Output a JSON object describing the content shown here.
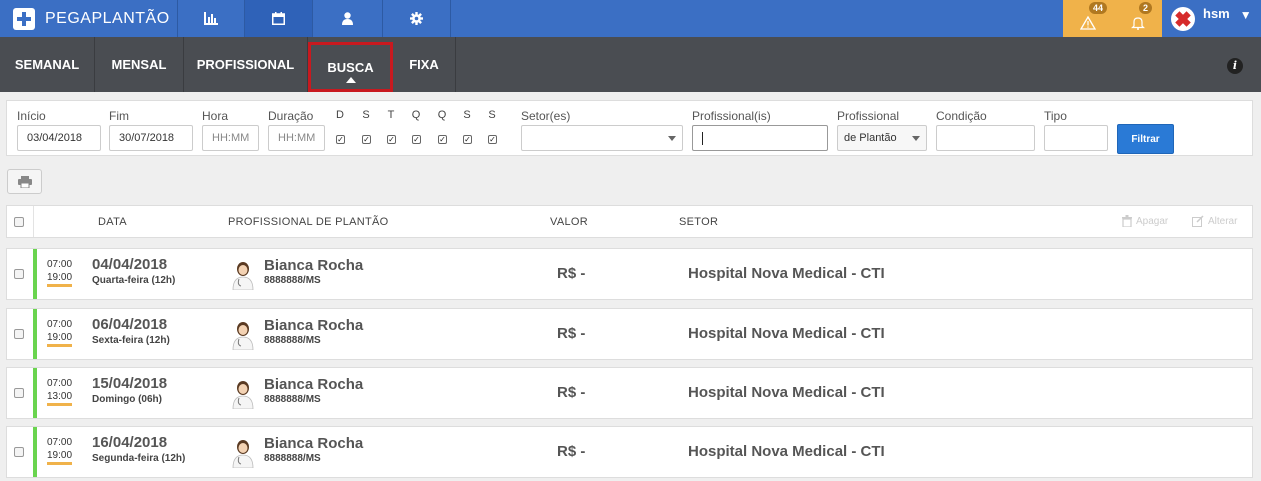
{
  "app": {
    "logo_text": "PEGAPLANTÃO"
  },
  "topnav": [
    "chart-icon",
    "calendar-icon",
    "user-icon",
    "gear-icon"
  ],
  "alerts": {
    "warnings_count": "44",
    "notifications_count": "2"
  },
  "user": {
    "name": "hsm"
  },
  "tabs": [
    "SEMANAL",
    "MENSAL",
    "PROFISSIONAL",
    "BUSCA",
    "FIXA"
  ],
  "active_tab": "BUSCA",
  "filters": {
    "inicio_label": "Início",
    "inicio_value": "03/04/2018",
    "fim_label": "Fim",
    "fim_value": "30/07/2018",
    "hora_label": "Hora",
    "hora_placeholder": "HH:MM",
    "duracao_label": "Duração",
    "duracao_placeholder": "HH:MM",
    "days": [
      "D",
      "S",
      "T",
      "Q",
      "Q",
      "S",
      "S"
    ],
    "setor_label": "Setor(es)",
    "profissionais_label": "Profissional(is)",
    "profissional_label": "Profissional",
    "profissional_value": "de Plantão",
    "condicao_label": "Condição",
    "tipo_label": "Tipo",
    "filter_button": "Filtrar"
  },
  "table": {
    "headers": {
      "data": "DATA",
      "profissional": "PROFISSIONAL DE PLANTÃO",
      "valor": "VALOR",
      "setor": "SETOR"
    },
    "actions": {
      "delete": "Apagar",
      "edit": "Alterar"
    },
    "rows": [
      {
        "start": "07:00",
        "end": "19:00",
        "date": "04/04/2018",
        "weekday": "Quarta-feira (12h)",
        "name": "Bianca Rocha",
        "reg": "8888888/MS",
        "value": "R$ -",
        "sector": "Hospital Nova Medical - CTI"
      },
      {
        "start": "07:00",
        "end": "19:00",
        "date": "06/04/2018",
        "weekday": "Sexta-feira (12h)",
        "name": "Bianca Rocha",
        "reg": "8888888/MS",
        "value": "R$ -",
        "sector": "Hospital Nova Medical - CTI"
      },
      {
        "start": "07:00",
        "end": "13:00",
        "date": "15/04/2018",
        "weekday": "Domingo (06h)",
        "name": "Bianca Rocha",
        "reg": "8888888/MS",
        "value": "R$ -",
        "sector": "Hospital Nova Medical - CTI"
      },
      {
        "start": "07:00",
        "end": "19:00",
        "date": "16/04/2018",
        "weekday": "Segunda-feira (12h)",
        "name": "Bianca Rocha",
        "reg": "8888888/MS",
        "value": "R$ -",
        "sector": "Hospital Nova Medical - CTI"
      }
    ]
  },
  "colors": {
    "primary": "#3b6fc4",
    "subnav": "#4a4d52",
    "alert": "#f0b24a",
    "active_outline": "#c8191f",
    "row_bar": "#6ad44f",
    "button": "#2a7ad6"
  }
}
